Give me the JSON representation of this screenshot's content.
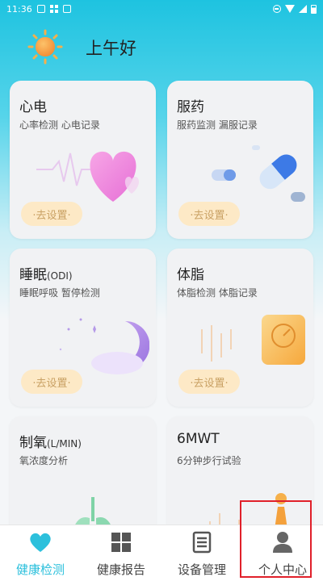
{
  "status_bar": {
    "time": "11:36"
  },
  "header": {
    "greeting": "上午好"
  },
  "cards": [
    {
      "id": "ecg",
      "title": "心电",
      "unit": "",
      "subtitle": "心率检测 心电记录",
      "button": "·去设置·"
    },
    {
      "id": "medication",
      "title": "服药",
      "unit": "",
      "subtitle": "服药监测 漏服记录",
      "button": "·去设置·"
    },
    {
      "id": "sleep",
      "title": "睡眠",
      "unit": "(ODI)",
      "subtitle": "睡眠呼吸 暂停检测",
      "button": "·去设置·"
    },
    {
      "id": "body-fat",
      "title": "体脂",
      "unit": "",
      "subtitle": "体脂检测 体脂记录",
      "button": "·去设置·"
    },
    {
      "id": "oxygen",
      "title": "制氧",
      "unit": "(L/MIN)",
      "subtitle": "氧浓度分析",
      "button": ""
    },
    {
      "id": "6mwt",
      "title": "6MWT",
      "unit": "",
      "subtitle": "6分钟步行试验",
      "button": ""
    }
  ],
  "bottom_nav": [
    {
      "label": "健康检测",
      "icon": "heart-icon",
      "active": true
    },
    {
      "label": "健康报告",
      "icon": "grid-icon",
      "active": false
    },
    {
      "label": "设备管理",
      "icon": "device-list-icon",
      "active": false
    },
    {
      "label": "个人中心",
      "icon": "person-icon",
      "active": false
    }
  ],
  "colors": {
    "accent": "#2cc0dc",
    "button_bg": "#fde9c6",
    "button_text": "#c9a164",
    "highlight": "#e0202a"
  }
}
